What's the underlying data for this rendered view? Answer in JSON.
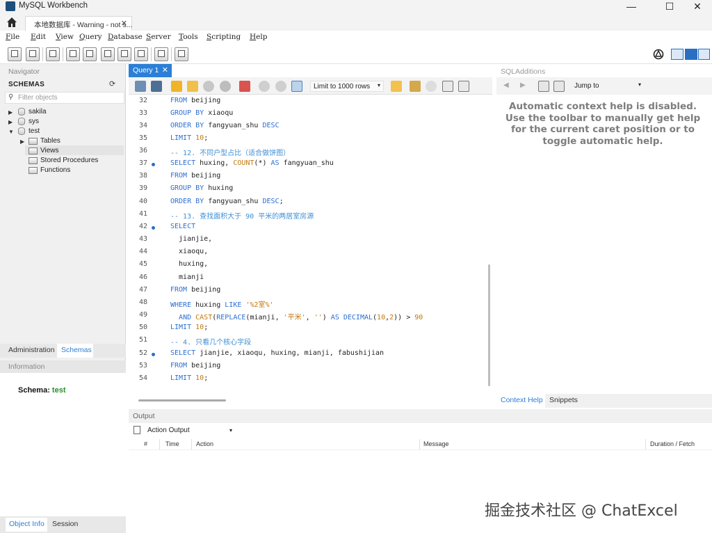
{
  "window": {
    "title": "MySQL Workbench",
    "controls": {
      "minimize": "—",
      "maximize": "☐",
      "close": "✕"
    }
  },
  "connection_tab": {
    "label": "本地数据库 - Warning - not s...",
    "close": "✕"
  },
  "menu": {
    "file": {
      "key": "F",
      "rest": "ile"
    },
    "edit": {
      "key": "E",
      "rest": "dit"
    },
    "view": {
      "key": "V",
      "rest": "iew"
    },
    "query": {
      "key": "Q",
      "rest": "uery"
    },
    "database": {
      "key": "D",
      "rest": "atabase"
    },
    "server": {
      "key": "S",
      "rest": "erver"
    },
    "tools": {
      "key": "T",
      "rest": "ools"
    },
    "scripting": {
      "key": "S",
      "rest": "cripting"
    },
    "help": {
      "key": "H",
      "rest": "elp"
    }
  },
  "navigator": {
    "title": "Navigator",
    "schemas_label": "SCHEMAS",
    "filter_placeholder": "Filter objects",
    "tree": {
      "sakila": "sakila",
      "sys": "sys",
      "test": "test",
      "tables": "Tables",
      "views": "Views",
      "stored_procedures": "Stored Procedures",
      "functions": "Functions"
    },
    "tabs": {
      "administration": "Administration",
      "schemas": "Schemas"
    },
    "info_title": "Information",
    "schema_label": "Schema:",
    "schema_value": "test",
    "bottom_tabs": {
      "object_info": "Object Info",
      "session": "Session"
    }
  },
  "query_tab": {
    "label": "Query 1",
    "close": "✕"
  },
  "editor_toolbar": {
    "limit_select": "Limit to 1000 rows",
    "arrow": "▾"
  },
  "editor": {
    "line_numbers": [
      "32",
      "33",
      "34",
      "35",
      "36",
      "37",
      "38",
      "39",
      "40",
      "41",
      "42",
      "43",
      "44",
      "45",
      "46",
      "47",
      "48",
      "49",
      "50",
      "51",
      "52",
      "53",
      "54"
    ],
    "lines": {
      "l32": {
        "a": "FROM",
        "b": " beijing"
      },
      "l33": {
        "a": "GROUP BY",
        "b": " xiaoqu"
      },
      "l34": {
        "a": "ORDER BY",
        "b": " fangyuan_shu ",
        "c": "DESC"
      },
      "l35": {
        "a": "LIMIT",
        "b": " ",
        "n": "10",
        "e": ";"
      },
      "l36": {
        "cm": "-- 12. 不同户型占比（适合做饼图）"
      },
      "l37": {
        "a": "SELECT",
        "b": " huxing, ",
        "f": "COUNT",
        "c": "(*) ",
        "d": "AS",
        "e": " fangyuan_shu"
      },
      "l38": {
        "a": "FROM",
        "b": " beijing"
      },
      "l39": {
        "a": "GROUP BY",
        "b": " huxing"
      },
      "l40": {
        "a": "ORDER BY",
        "b": " fangyuan_shu ",
        "c": "DESC",
        "e": ";"
      },
      "l41": {
        "cm": "-- 13. 查找面积大于 90 平米的两居室房源"
      },
      "l42": {
        "a": "SELECT"
      },
      "l43": {
        "b": "  jianjie,"
      },
      "l44": {
        "b": "  xiaoqu,"
      },
      "l45": {
        "b": "  huxing,"
      },
      "l46": {
        "b": "  mianji"
      },
      "l47": {
        "a": "FROM",
        "b": " beijing"
      },
      "l48": {
        "a": "WHERE",
        "b": " huxing ",
        "c": "LIKE",
        "s": " '%2室%'"
      },
      "l49": {
        "p": "  ",
        "a": "AND",
        "b": " ",
        "f": "CAST",
        "c": "(",
        "f2": "REPLACE",
        "d": "(mianji, ",
        "s": "'平米'",
        "e": ", ",
        "s2": "''",
        "g": ") ",
        "a2": "AS DECIMAL",
        "h": "(",
        "n": "10",
        "i": ",",
        "n2": "2",
        "j": ")) > ",
        "n3": "90"
      },
      "l50": {
        "a": "LIMIT",
        "b": " ",
        "n": "10",
        "e": ";"
      },
      "l51": {
        "cm": "-- 4. 只看几个核心字段"
      },
      "l52": {
        "a": "SELECT",
        "b": " jianjie, xiaoqu, huxing, mianji, fabushijian"
      },
      "l53": {
        "a": "FROM",
        "b": " beijing"
      },
      "l54": {
        "a": "LIMIT",
        "b": " ",
        "n": "10",
        "e": ";"
      }
    }
  },
  "sql_additions": {
    "title": "SQLAdditions",
    "jump_to": "Jump to",
    "help_text": "Automatic context help is disabled. Use the toolbar to manually get help for the current caret position or to toggle automatic help.",
    "tabs": {
      "context_help": "Context Help",
      "snippets": "Snippets"
    }
  },
  "output": {
    "title": "Output",
    "selector": "Action Output",
    "columns": {
      "num": "#",
      "time": "Time",
      "action": "Action",
      "message": "Message",
      "duration": "Duration / Fetch"
    }
  },
  "watermark": "掘金技术社区 @ ChatExcel",
  "colors": {
    "accent": "#2b7fd6",
    "keyword": "#2e6fd0",
    "function": "#c2780f",
    "comment": "#3f8fd6",
    "schema_value": "#2a8c2a"
  }
}
